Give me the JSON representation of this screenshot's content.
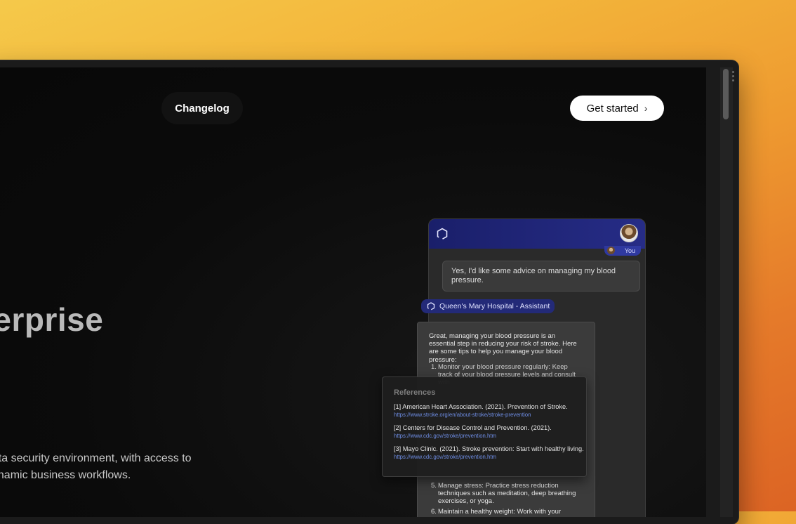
{
  "nav": {
    "changelog_label": "Changelog",
    "get_started_label": "Get started",
    "get_started_chevron": "›"
  },
  "hero": {
    "title": "nterprise",
    "subtitle_line1": "data security environment, with access to",
    "subtitle_line2": "dynamic business workflows."
  },
  "chat": {
    "you_label": "You",
    "user_message": "Yes, I'd like some advice on managing my blood pressure.",
    "assistant_name": "Queen's Mary Hospital - Assistant",
    "assistant_intro": "Great, managing your blood pressure is an essential step in reducing your risk of stroke. Here are some tips to help you manage your blood pressure:",
    "tips": [
      {
        "num": "1.",
        "text": "Monitor your blood pressure regularly: Keep track of your blood pressure levels and consult with"
      },
      {
        "num": "5.",
        "text": "Manage stress: Practice stress reduction techniques such as meditation, deep breathing exercises, or yoga."
      },
      {
        "num": "6.",
        "text": "Maintain a healthy weight: Work with your"
      }
    ]
  },
  "references": {
    "title": "References",
    "items": [
      {
        "cite": "[1] American Heart Association. (2021). Prevention of Stroke.",
        "url": "https://www.stroke.org/en/about-stroke/stroke-prevention"
      },
      {
        "cite": "[2] Centers for Disease Control and Prevention. (2021).",
        "url": "https://www.cdc.gov/stroke/prevention.htm"
      },
      {
        "cite": "[3] Mayo Clinic. (2021). Stroke prevention: Start with healthy living.",
        "url": "https://www.cdc.gov/stroke/prevention.htm"
      }
    ]
  },
  "colors": {
    "background_gradient_start": "#f5c94a",
    "background_gradient_end": "#dc6424",
    "chat_header": "#262c86",
    "link": "#6e8de4"
  },
  "icons": [
    "app-logo-icon",
    "user-avatar",
    "chevron-right-icon",
    "window-menu-dots-icon"
  ]
}
